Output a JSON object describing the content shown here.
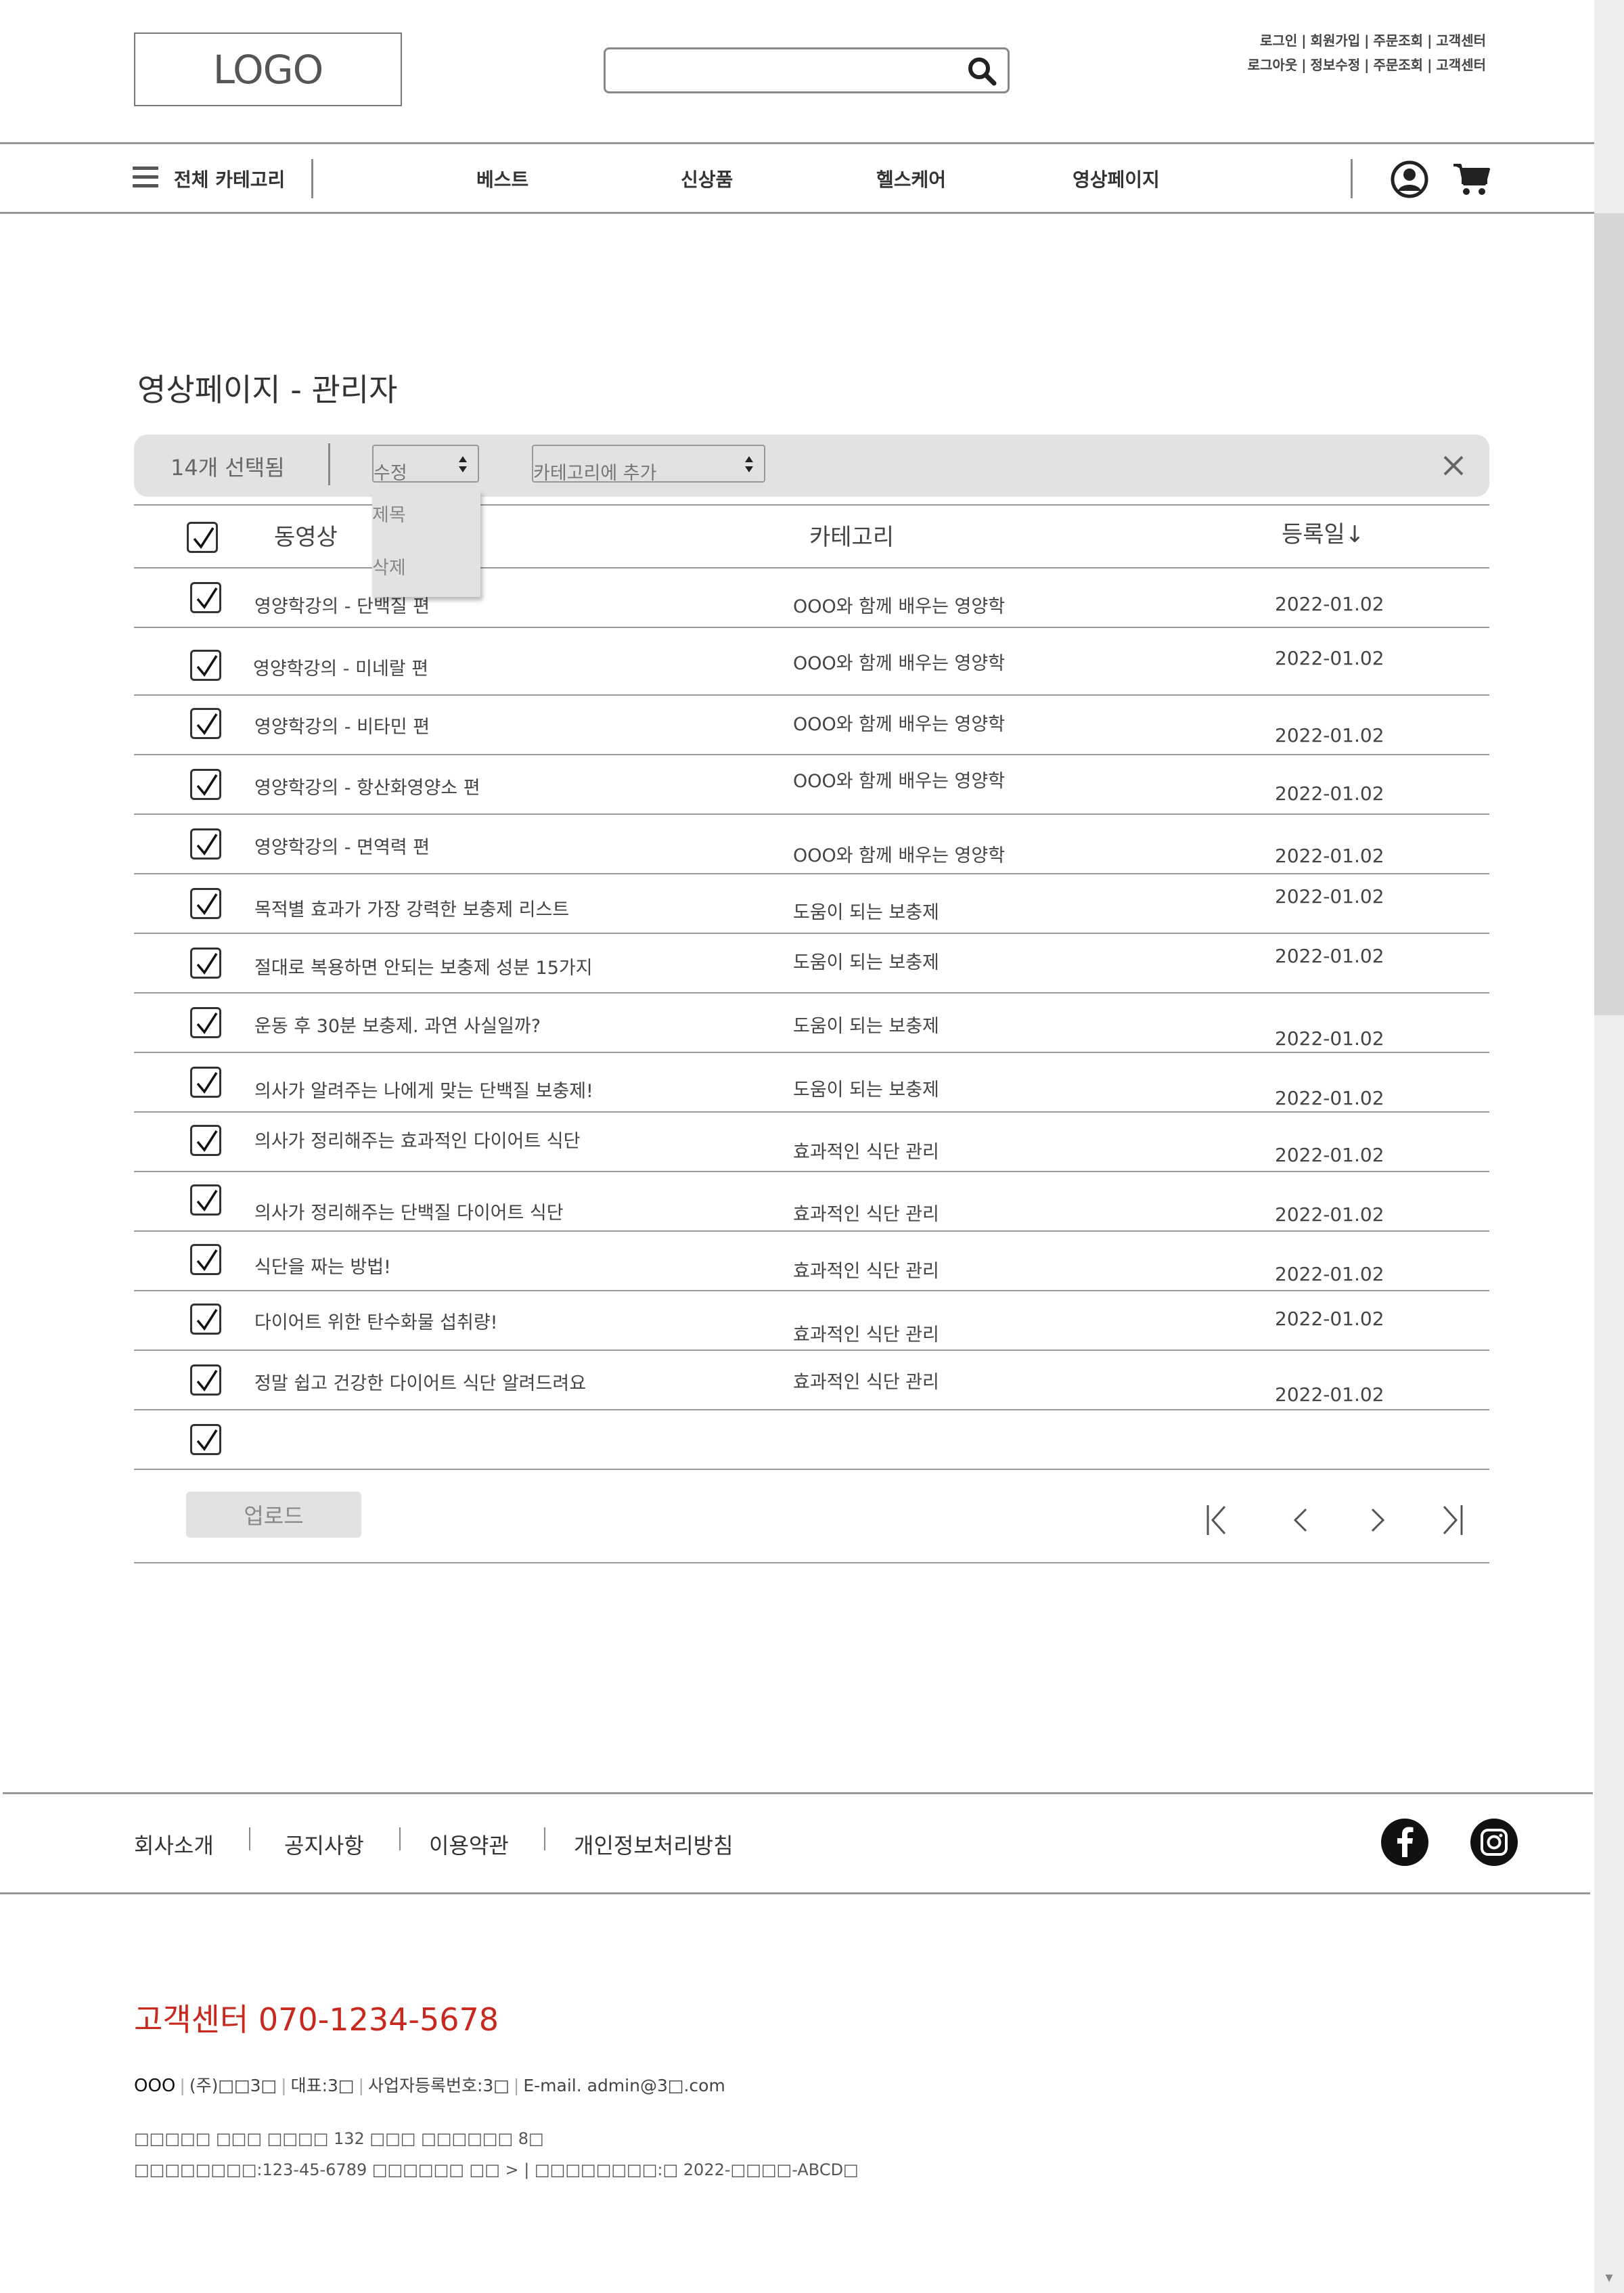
{
  "header": {
    "logo": "LOGO",
    "search_placeholder": "",
    "util_links_line1": [
      "로그인",
      "회원가입",
      "주문조회",
      "고객센터"
    ],
    "util_links_line2": [
      "로그아웃",
      "정보수정",
      "주문조회",
      "고객센터"
    ]
  },
  "nav": {
    "all_categories": "전체 카테고리",
    "items": [
      "베스트",
      "신상품",
      "헬스케어",
      "영상페이지"
    ]
  },
  "page": {
    "title": "영상페이지 - 관리자"
  },
  "action_bar": {
    "selected_count": "14개 선택됨",
    "edit_select": "수정",
    "category_select": "카테고리에 추가",
    "dropdown_options": [
      "제목",
      "삭제"
    ]
  },
  "table": {
    "headers": {
      "video": "동영상",
      "category": "카테고리",
      "date": "등록일↓"
    },
    "rows": [
      {
        "title": "영양학강의 - 단백질 편",
        "category": "OOO와 함께 배우는 영양학",
        "date": "2022-01.02",
        "checked": true
      },
      {
        "title": "영양학강의 - 미네랄 편",
        "category": "OOO와 함께 배우는 영양학",
        "date": "2022-01.02",
        "checked": true
      },
      {
        "title": "영양학강의 - 비타민 편",
        "category": "OOO와 함께 배우는 영양학",
        "date": "2022-01.02",
        "checked": true
      },
      {
        "title": "영양학강의 - 항산화영양소 편",
        "category": "OOO와 함께 배우는 영양학",
        "date": "2022-01.02",
        "checked": true
      },
      {
        "title": "영양학강의 - 면역력 편",
        "category": "OOO와 함께 배우는 영양학",
        "date": "2022-01.02",
        "checked": true
      },
      {
        "title": "목적별 효과가 가장 강력한 보충제 리스트",
        "category": "도움이 되는 보충제",
        "date": "2022-01.02",
        "checked": true
      },
      {
        "title": "절대로 복용하면 안되는 보충제 성분 15가지",
        "category": "도움이 되는 보충제",
        "date": "2022-01.02",
        "checked": true
      },
      {
        "title": "운동 후 30분 보충제. 과연 사실일까?",
        "category": "도움이 되는 보충제",
        "date": "2022-01.02",
        "checked": true
      },
      {
        "title": "의사가 알려주는 나에게 맞는 단백질 보충제!",
        "category": "도움이 되는 보충제",
        "date": "2022-01.02",
        "checked": true
      },
      {
        "title": "의사가 정리해주는 효과적인 다이어트 식단",
        "category": "효과적인 식단 관리",
        "date": "2022-01.02",
        "checked": true
      },
      {
        "title": "의사가 정리해주는 단백질 다이어트 식단",
        "category": "효과적인 식단 관리",
        "date": "2022-01.02",
        "checked": true
      },
      {
        "title": "식단을 짜는 방법!",
        "category": "효과적인 식단 관리",
        "date": "2022-01.02",
        "checked": true
      },
      {
        "title": "다이어트 위한 탄수화물 섭취량!",
        "category": "효과적인 식단 관리",
        "date": "2022-01.02",
        "checked": true
      },
      {
        "title": "정말 쉽고 건강한 다이어트 식단 알려드려요",
        "category": "효과적인 식단 관리",
        "date": "2022-01.02",
        "checked": true
      },
      {
        "title": "",
        "category": "",
        "date": "",
        "checked": true
      }
    ],
    "upload_button": "업로드"
  },
  "footer": {
    "links": [
      "회사소개",
      "공지사항",
      "이용약관",
      "개인정보처리방침"
    ],
    "customer_center": "고객센터  070-1234-5678",
    "company_owner": "OOO",
    "company_info": [
      "(주)□□3□",
      "대표:3□",
      "사업자등록번호:3□",
      "E-mail. admin@3□.com"
    ],
    "address": "□□□□□ □□□ □□□□ 132 □□□ □□□□□□ 8□",
    "business_line": "□□□□□□□□:123-45-6789 □□□□□□ □□ > | □□□□□□□□:□ 2022-□□□□-ABCD□"
  }
}
